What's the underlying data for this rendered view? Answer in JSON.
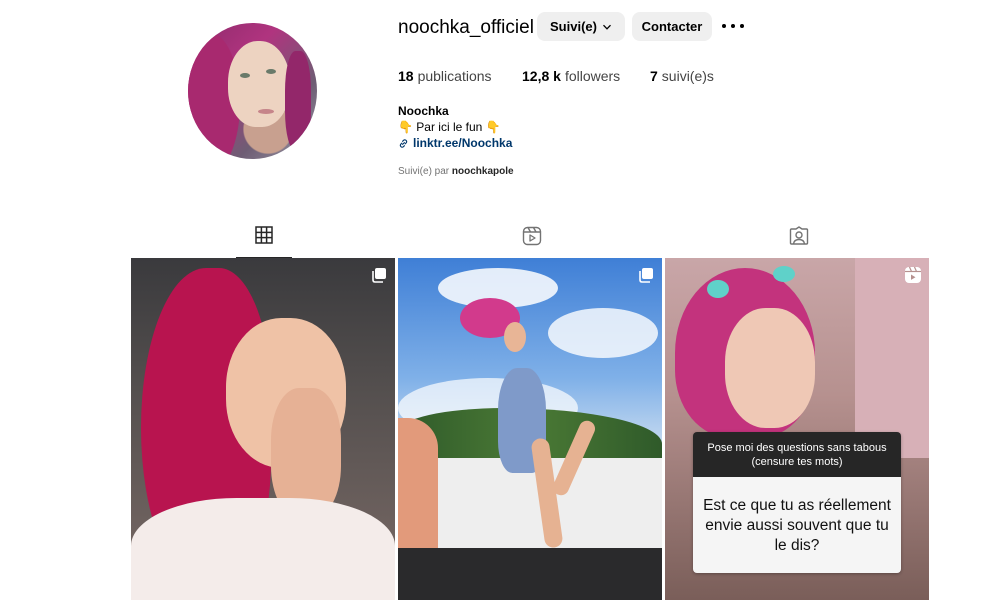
{
  "profile": {
    "username": "noochka_officiel",
    "follow_button": "Suivi(e)",
    "contact_button": "Contacter",
    "stats": {
      "posts_count": "18",
      "posts_label": "publications",
      "followers_count": "12,8 k",
      "followers_label": "followers",
      "following_count": "7",
      "following_label": "suivi(e)s"
    },
    "bio": {
      "name": "Noochka",
      "line": "👇  Par ici le fun  👇",
      "link": "linktr.ee/Noochka"
    },
    "followed_by_prefix": "Suivi(e) par",
    "followed_by_user": "noochkapole"
  },
  "tabs": [
    {
      "icon": "grid-icon",
      "active": true
    },
    {
      "icon": "reels-icon",
      "active": false
    },
    {
      "icon": "tagged-icon",
      "active": false
    }
  ],
  "posts": [
    {
      "type": "carousel",
      "icon": "carousel-icon"
    },
    {
      "type": "carousel",
      "icon": "carousel-icon"
    },
    {
      "type": "reel",
      "icon": "reel-icon"
    }
  ],
  "question_sticker": {
    "prompt": "Pose moi des questions sans tabous (censure tes mots)",
    "question": "Est ce que tu as réellement envie aussi souvent que tu le dis?"
  },
  "colors": {
    "button_bg": "#efefef",
    "link": "#00376b",
    "muted": "#737373"
  }
}
